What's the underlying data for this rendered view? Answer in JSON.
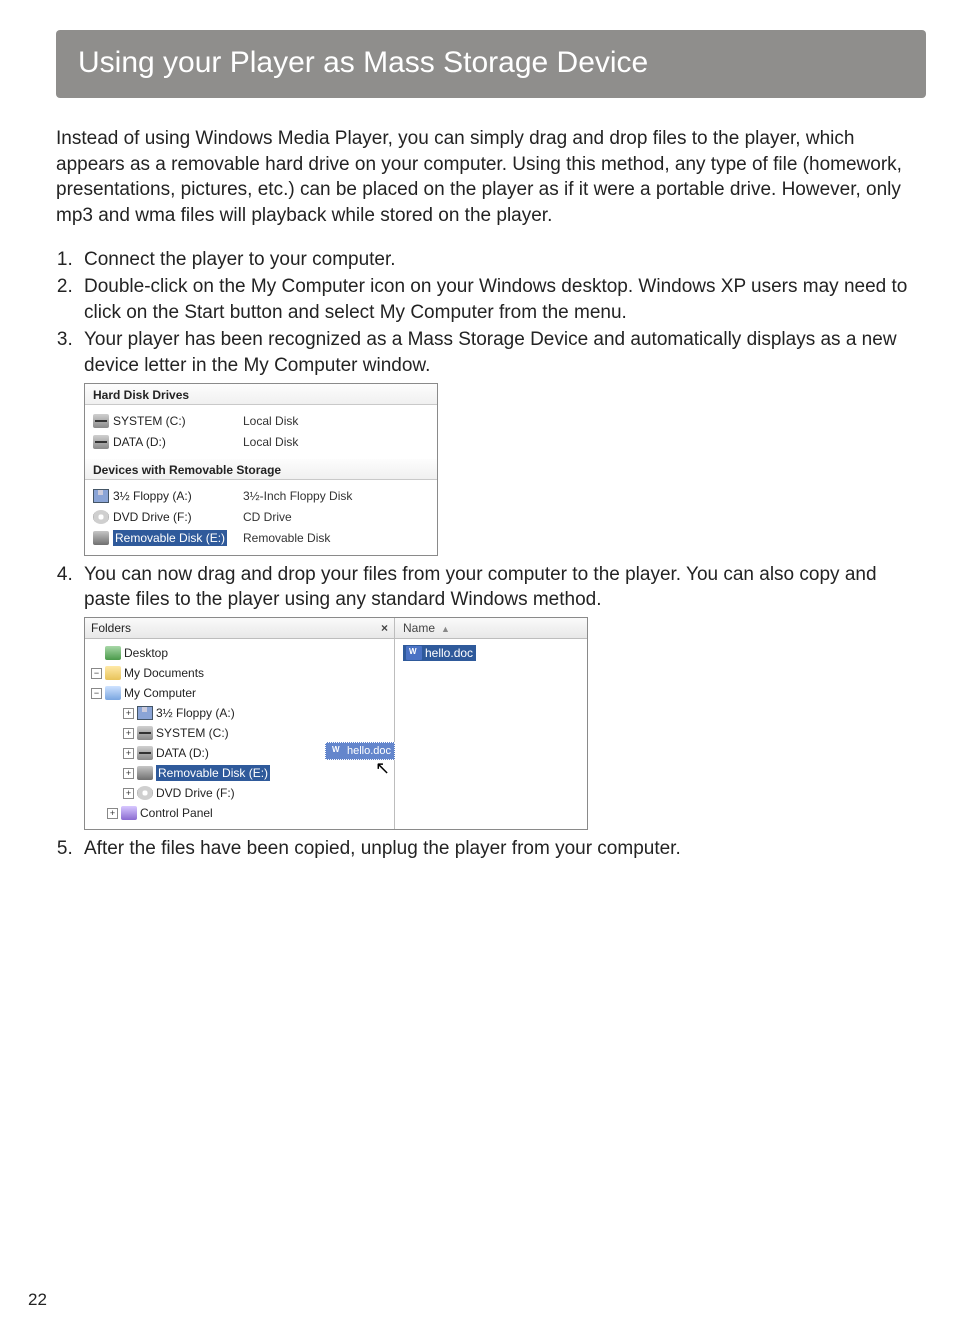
{
  "page_number": "22",
  "title": "Using your Player as Mass Storage Device",
  "intro": "Instead of using Windows Media Player, you can simply drag and drop files to the player, which appears as a removable hard drive on your computer. Using this method, any type of file (homework, presentations, pictures, etc.) can be placed on the player as if it were a portable drive. However, only mp3 and wma files will playback while stored on the player.",
  "steps": {
    "s1": "Connect the player to your computer.",
    "s2": "Double-click on the My Computer icon on your Windows desktop. Windows XP users may need to click on the Start button and select My Computer from the menu.",
    "s3": "Your player has been recognized as a Mass Storage Device and automatically displays as a new device letter in the My Computer window.",
    "s4": "You can now drag and drop your files from your computer to the player. You can also copy and paste files to the player using any standard Windows method.",
    "s5": "After the files have been copied, unplug the player from your computer."
  },
  "fig1": {
    "head1": "Hard Disk Drives",
    "r1_label": "SYSTEM (C:)",
    "r1_type": "Local Disk",
    "r2_label": "DATA (D:)",
    "r2_type": "Local Disk",
    "head2": "Devices with Removable Storage",
    "r3_label": "3½ Floppy (A:)",
    "r3_type": "3½-Inch Floppy Disk",
    "r4_label": "DVD Drive (F:)",
    "r4_type": "CD Drive",
    "r5_label": "Removable Disk (E:)",
    "r5_type": "Removable Disk"
  },
  "fig2": {
    "folders_label": "Folders",
    "close_x": "×",
    "name_col": "Name",
    "sort_glyph": "▲",
    "tree": {
      "desktop": "Desktop",
      "mydocs": "My Documents",
      "mycomp": "My Computer",
      "floppy": "3½ Floppy (A:)",
      "system": "SYSTEM (C:)",
      "data": "DATA (D:)",
      "removable": "Removable Disk (E:)",
      "dvd": "DVD Drive (F:)",
      "cpanel": "Control Panel"
    },
    "drag_file": "hello.doc",
    "listed_file": "hello.doc"
  }
}
